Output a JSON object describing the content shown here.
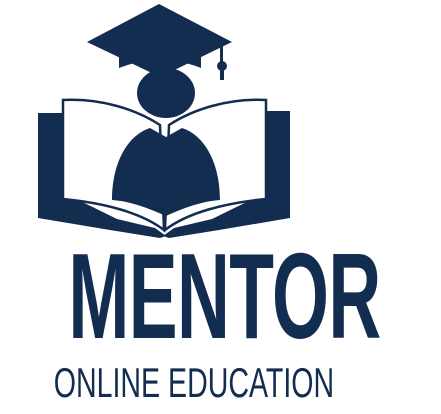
{
  "logo": {
    "brand_name": "MENTOR",
    "tagline": "ONLINE EDUCATION",
    "icon": "graduate-reading-book-icon",
    "colors": {
      "primary": "#132d51",
      "background": "#ffffff",
      "page": "#ffffff"
    }
  }
}
